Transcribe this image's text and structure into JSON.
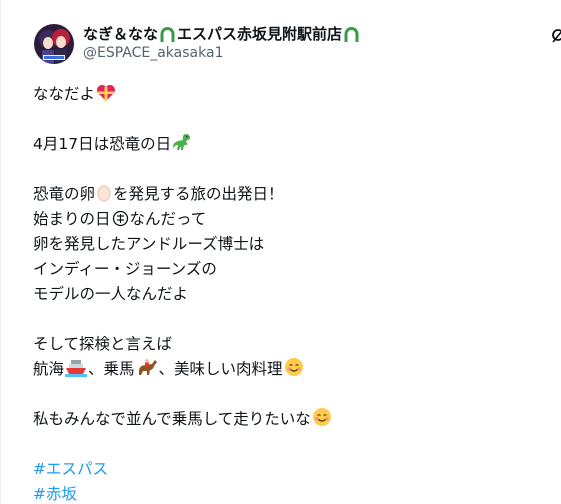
{
  "post": {
    "author": {
      "display_name_pre": "なぎ＆なな",
      "display_name_mid": "エスパス赤坂見附駅前店",
      "handle": "@ESPACE_akasaka1",
      "avatar_icon": "character-avatar-icon",
      "name_emoji": "horseshoe-icon"
    },
    "lines": {
      "l1": "ななだよ",
      "l2": "4月17日は恐竜の日",
      "l3a": "恐竜の卵",
      "l3b": "を発見する旅の出発日！",
      "l4a": "始まりの日",
      "l4b": "なんだって",
      "l5": "卵を発見したアンドルーズ博士は",
      "l6": "インディー・ジョーンズの",
      "l7": "モデルの一人なんだよ",
      "l8": "そして探検と言えば",
      "l9a": "航海",
      "l9b": "、乗馬",
      "l9c": "、美味しい肉料理",
      "l10": "私もみんなで並んで乗馬して走りたいな"
    },
    "hashtags": [
      "#エスパス",
      "#赤坂"
    ],
    "colors": {
      "text": "#0f1419",
      "secondary": "#536471",
      "link": "#1d9bf0"
    }
  }
}
